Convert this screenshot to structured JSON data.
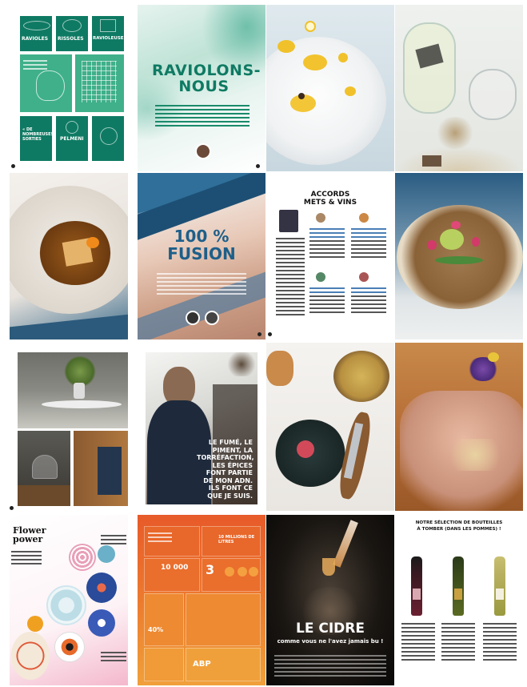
{
  "spreads": {
    "raviolons": {
      "title": "RAVIOLONS-NOUS",
      "title_line1": "RAVIOLONS-",
      "title_line2": "NOUS"
    },
    "infographic_top": {
      "label_ravioles": "RAVIOLES",
      "label_rissoles": "RISSOLES",
      "label_ravioleuse": "RAVIOLEUSE",
      "label_sorties": "« DE NOMBREUSES SORTIES",
      "label_pelmeni": "PELMENI"
    },
    "fusion": {
      "title": "100 % FUSION",
      "title_line1": "100 %",
      "title_line2": "FUSION"
    },
    "accords": {
      "title_line1": "ACCORDS",
      "title_line2": "METS & VINS"
    },
    "quote": {
      "lines": [
        "LE FUMÉ, LE",
        "PIMENT, LA",
        "TORRÉFACTION,",
        "LES ÉPICES",
        "FONT PARTIE",
        "DE MON ADN.",
        "ILS FONT CE",
        "QUE JE SUIS."
      ]
    },
    "flower": {
      "title_line1": "Flower",
      "title_line2": "power"
    },
    "infographic_orange": {
      "stat_10000": "10 000",
      "stat_3": "3",
      "stat_40": "40%",
      "stat_abp": "ABP",
      "stat_millions": "10 MILLIONS DE LITRES"
    },
    "cidre": {
      "title": "LE CIDRE",
      "subtitle": "comme vous ne l'avez jamais bu !"
    },
    "bouteilles": {
      "title_line1": "NOTRE SÉLECTION DE BOUTEILLES",
      "title_line2": "À TOMBER (DANS LES POMMES) !"
    }
  },
  "colors": {
    "teal": "#0f7a63",
    "teal_light": "#3fb08a",
    "blue_title": "#1d5f8a",
    "orange": "#e8672a",
    "orange_light": "#f09a3a",
    "black": "#111111"
  }
}
